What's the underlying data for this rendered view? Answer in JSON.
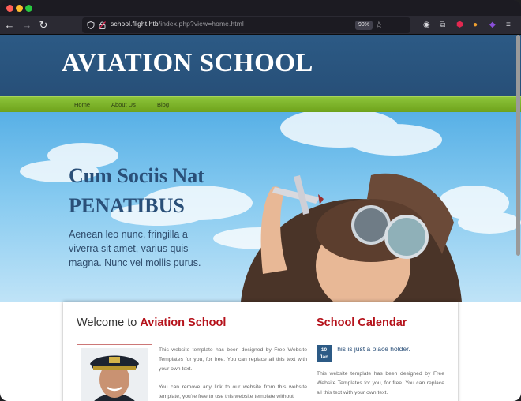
{
  "browser": {
    "url_host": "school.flight.htb",
    "url_path": "/index.php?view=home.html",
    "zoom": "90%",
    "colors": {
      "close": "#ff5f57",
      "minimize": "#febc2e",
      "maximize": "#28c840"
    }
  },
  "site": {
    "title": "AVIATION SCHOOL",
    "menu": [
      "Home",
      "About Us",
      "Blog"
    ]
  },
  "hero": {
    "heading_line1": "Cum Sociis Nat",
    "heading_line2": "PENATIBUS",
    "text": "Aenean leo nunc, fringilla a viverra sit amet, varius quis magna. Nunc vel mollis purus."
  },
  "welcome": {
    "prefix": "Welcome to",
    "highlight": "Aviation School",
    "para1": "This website template has been designed by Free Website Templates for you, for free. You can replace all this text with your own text.",
    "para2": "You can remove any link to our website from this website template, you're free to use this website template without"
  },
  "calendar": {
    "title": "School Calendar",
    "date_day": "10",
    "date_month": "Jan",
    "event_title": "This is just a place holder.",
    "event_text": "This website template has been designed by Free Website Templates for you, for free. You can replace all this text with your own text."
  }
}
